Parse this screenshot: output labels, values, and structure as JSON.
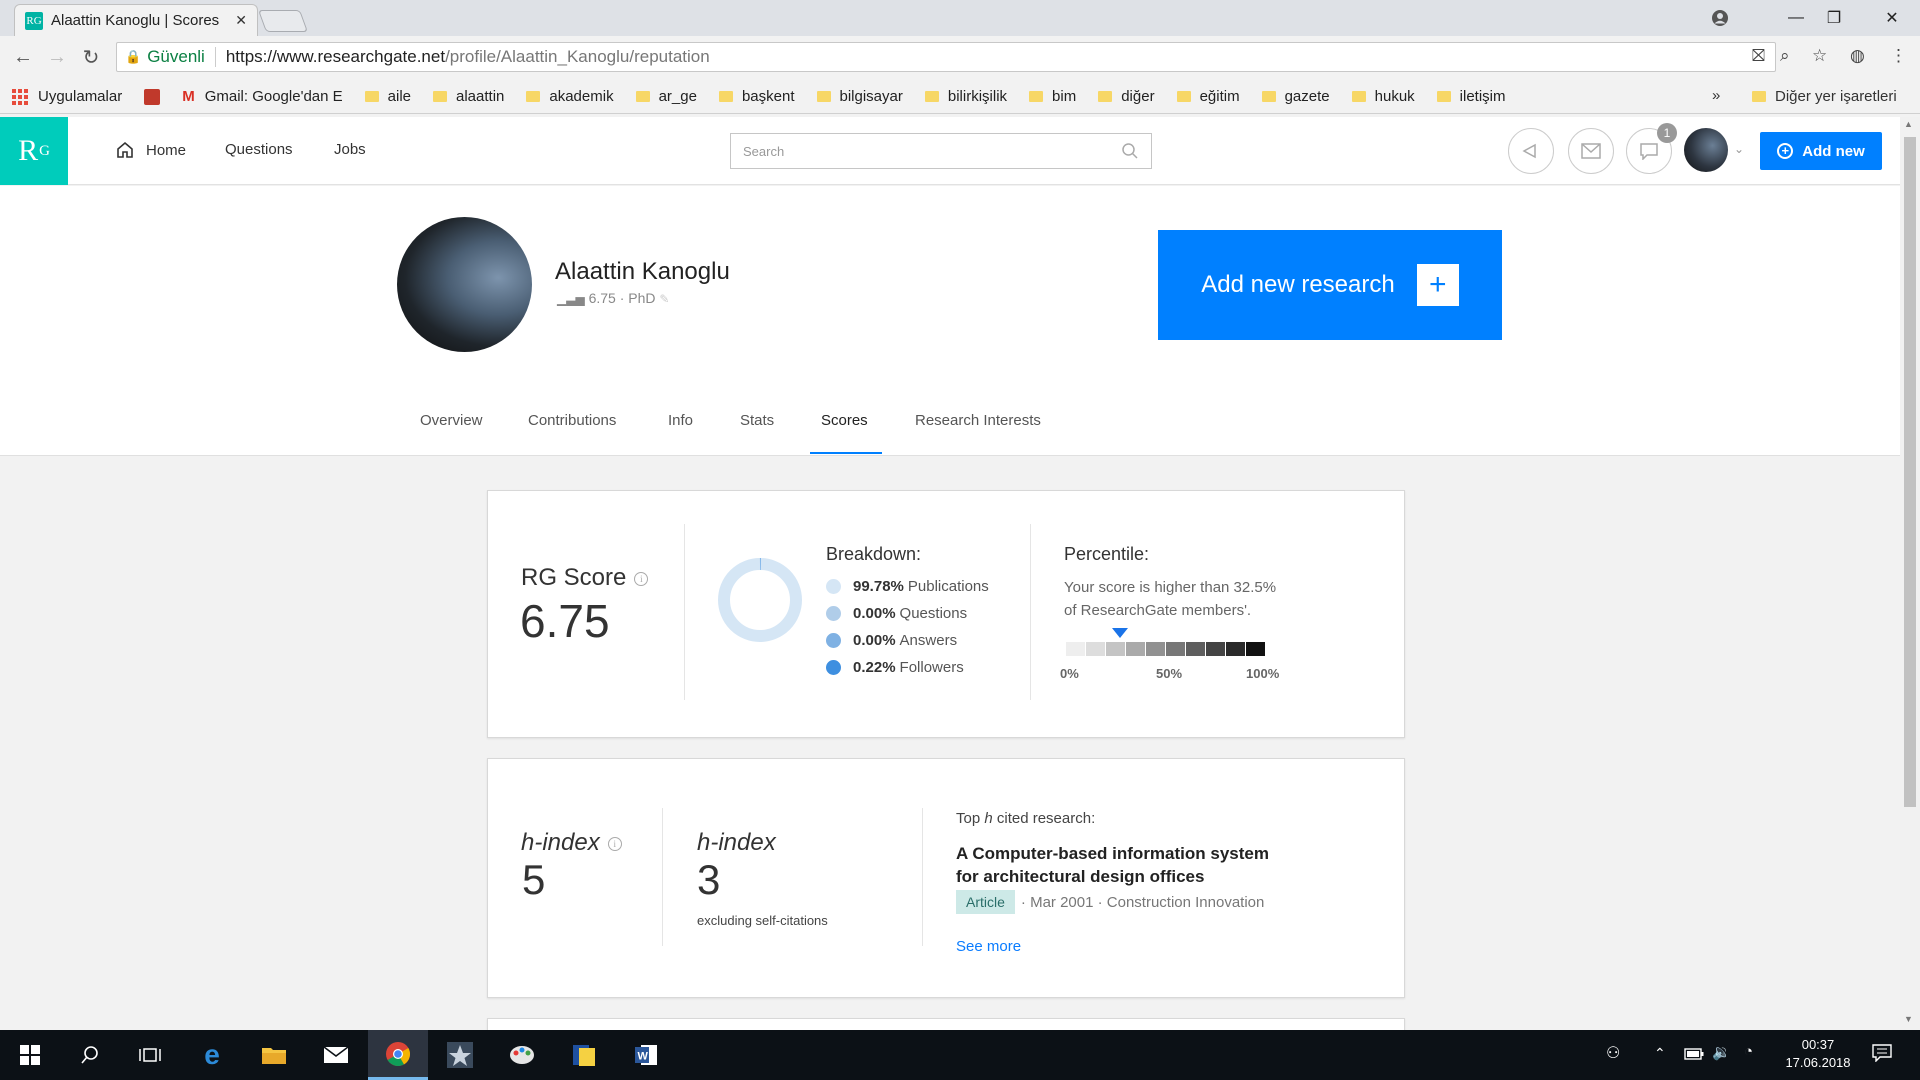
{
  "browser": {
    "tab_title": "Alaattin Kanoglu | Scores",
    "tab_favicon": "RG",
    "url_secure_label": "Güvenli",
    "url_host": "https://www.researchgate.net",
    "url_path": "/profile/Alaattin_Kanoglu/reputation",
    "bookmarks": [
      {
        "label": "Uygulamalar",
        "icon": "apps-icon"
      },
      {
        "label": "",
        "icon": "toolbox-icon"
      },
      {
        "label": "Gmail: Google'dan E",
        "icon": "gmail-icon"
      },
      {
        "label": "aile",
        "icon": "folder-icon"
      },
      {
        "label": "alaattin",
        "icon": "folder-icon"
      },
      {
        "label": "akademik",
        "icon": "folder-icon"
      },
      {
        "label": "ar_ge",
        "icon": "folder-icon"
      },
      {
        "label": "başkent",
        "icon": "folder-icon"
      },
      {
        "label": "bilgisayar",
        "icon": "folder-icon"
      },
      {
        "label": "bilirkişilik",
        "icon": "folder-icon"
      },
      {
        "label": "bim",
        "icon": "folder-icon"
      },
      {
        "label": "diğer",
        "icon": "folder-icon"
      },
      {
        "label": "eğitim",
        "icon": "folder-icon"
      },
      {
        "label": "gazete",
        "icon": "folder-icon"
      },
      {
        "label": "hukuk",
        "icon": "folder-icon"
      },
      {
        "label": "iletişim",
        "icon": "folder-icon"
      }
    ],
    "bookmarks_overflow": "»",
    "other_bookmarks": "Diğer yer işaretleri"
  },
  "rg_header": {
    "logo": "R",
    "logo_sup": "G",
    "nav": {
      "home": "Home",
      "questions": "Questions",
      "jobs": "Jobs"
    },
    "search_placeholder": "Search",
    "notification_count": "1",
    "add_new": "Add new"
  },
  "profile": {
    "name": "Alaattin Kanoglu",
    "score": "6.75",
    "degree": "PhD",
    "add_research": "Add new research",
    "tabs": {
      "overview": "Overview",
      "contributions": "Contributions",
      "info": "Info",
      "stats": "Stats",
      "scores": "Scores",
      "interests": "Research Interests"
    }
  },
  "rg_score": {
    "label": "RG Score",
    "value": "6.75",
    "breakdown_title": "Breakdown:",
    "breakdown": [
      {
        "pct": "99.78%",
        "label": "Publications",
        "color": "#d5e6f5"
      },
      {
        "pct": "0.00%",
        "label": "Questions",
        "color": "#b0cde9"
      },
      {
        "pct": "0.00%",
        "label": "Answers",
        "color": "#7fb1e3"
      },
      {
        "pct": "0.22%",
        "label": "Followers",
        "color": "#3e8fe0"
      }
    ],
    "percentile_title": "Percentile:",
    "percentile_text_1": "Your score is higher than 32.5%",
    "percentile_text_2": "of ResearchGate members'.",
    "percentile_value": 32.5,
    "scale_labels": [
      "0%",
      "50%",
      "100%"
    ]
  },
  "h_index": {
    "label": "h-index",
    "value": "5",
    "excl_label": "h-index",
    "excl_value": "3",
    "excl_note": "excluding self-citations",
    "top_cited_title_prefix": "Top ",
    "top_cited_title_h": "h",
    "top_cited_title_suffix": " cited research:",
    "paper_title_1": "A Computer-based information system",
    "paper_title_2": "for architectural design offices",
    "paper_type": "Article",
    "paper_meta": "· Mar 2001 · Construction Innovation",
    "see_more": "See more"
  },
  "taskbar": {
    "time": "00:37",
    "date": "17.06.2018"
  }
}
